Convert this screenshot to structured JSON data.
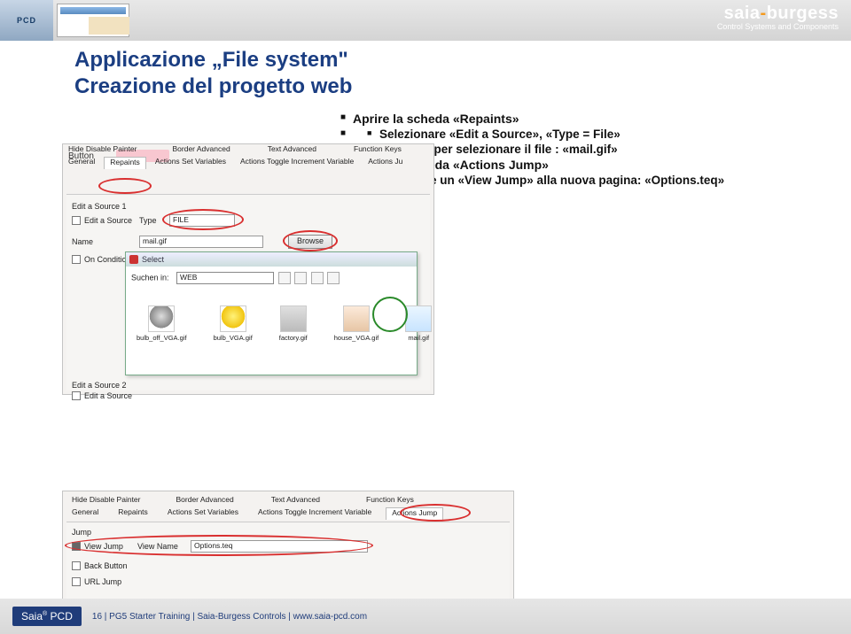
{
  "header": {
    "pcd": "PCD",
    "brand_a": "saia",
    "brand_b": "burgess",
    "tagline": "Control Systems and Components"
  },
  "title1": "Applicazione „File system\"",
  "title2": "Creazione del progetto web",
  "bullets": {
    "b1": "Aprire la scheda «Repaints»",
    "b2": "Selezionare «Edit a Source», «Type = File»",
    "b3": "Sfogliare per selezionare il file : «mail.gif»",
    "b4": "Aprire la scheda «Actions Jump»",
    "b5": "Impostare un «View Jump» alla nuova pagina: «Options.teq»"
  },
  "shot1": {
    "button": "Button",
    "tabs_top": [
      "Hide Disable Painter",
      "Border Advanced",
      "Text Advanced",
      "Function Keys"
    ],
    "tabs_bot": [
      "General",
      "Repaints",
      "Actions Set Variables",
      "Actions Toggle Increment Variable",
      "Actions Ju"
    ],
    "panel": {
      "edit_source1": "Edit a Source 1",
      "type": "Type",
      "type_val": "FILE",
      "name": "Name",
      "name_val": "mail.gif",
      "browse": "Browse",
      "on_condition": "On Condition",
      "edit_source2": "Edit a Source 2",
      "edit_source": "Edit a Source"
    },
    "select": {
      "title": "Select",
      "lookin": "Suchen in:",
      "folder": "WEB",
      "files": [
        "bulb_off_VGA.gif",
        "bulb_VGA.gif",
        "factory.gif",
        "house_VGA.gif",
        "mail.gif"
      ]
    }
  },
  "shot2": {
    "tabs_top": [
      "Hide Disable Painter",
      "Border Advanced",
      "Text Advanced",
      "Function Keys"
    ],
    "tabs_bot": [
      "General",
      "Repaints",
      "Actions Set Variables",
      "Actions Toggle Increment Variable",
      "Actions Jump"
    ],
    "panel": {
      "jump": "Jump",
      "view_jump": "View Jump",
      "view_name": "View Name",
      "view_name_val": "Options.teq",
      "back_button": "Back Button",
      "url_jump": "URL Jump"
    }
  },
  "footer": {
    "logo_a": "Saia",
    "logo_b": "PCD",
    "text": "16 | PG5 Starter Training | Saia-Burgess Controls | www.saia-pcd.com"
  }
}
